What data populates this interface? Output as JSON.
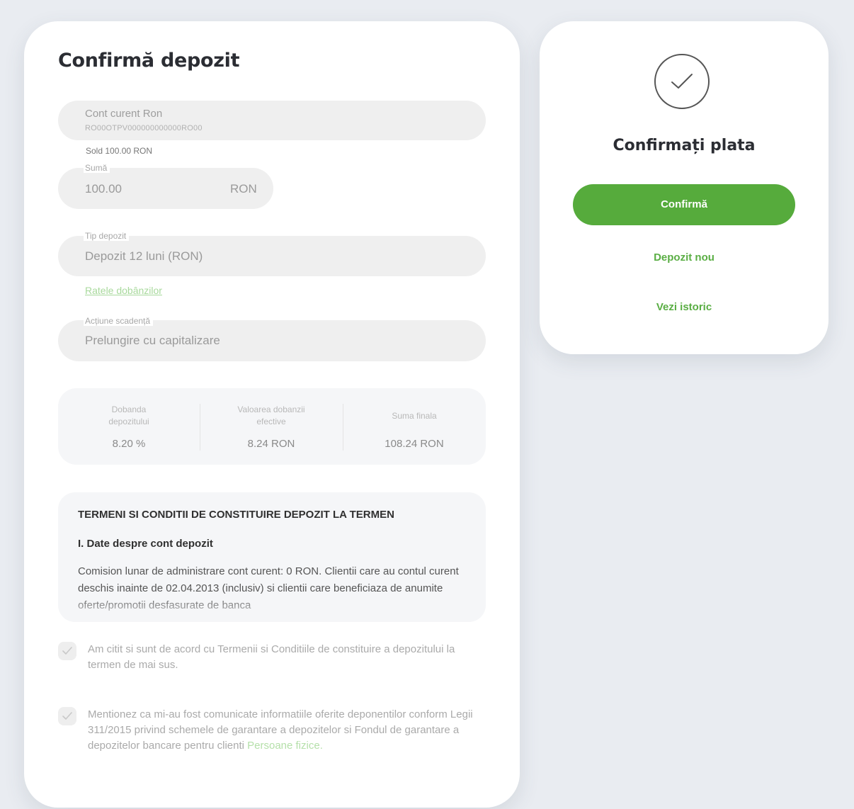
{
  "deposit": {
    "title": "Confirmă depozit",
    "account": {
      "name": "Cont curent Ron",
      "iban": "RO00OTPV000000000000RO00",
      "balance": "Sold  100.00  RON"
    },
    "amount": {
      "label": "Sumă",
      "value": "100.00",
      "currency": "RON"
    },
    "deposit_type": {
      "label": "Tip depozit",
      "value": "Depozit 12 luni (RON)"
    },
    "rates_link": "Ratele dobânzilor",
    "maturity_action": {
      "label": "Acțiune scadență",
      "value": "Prelungire cu capitalizare"
    },
    "summary": [
      {
        "label": "Dobanda depozitului",
        "value": "8.20 %"
      },
      {
        "label": "Valoarea dobanzii efective",
        "value": "8.24 RON"
      },
      {
        "label": "Suma finala",
        "value": "108.24 RON"
      }
    ],
    "terms": {
      "title": "TERMENI SI CONDITII DE CONSTITUIRE DEPOZIT LA TERMEN",
      "subtitle": "I. Date despre cont depozit",
      "text": "Comision lunar de administrare cont curent: 0 RON. Clientii care au contul curent deschis inainte de 02.04.2013 (inclusiv) si clientii care beneficiaza de anumite oferte/promotii desfasurate de banca"
    },
    "agreements": [
      {
        "text": "Am citit si sunt de acord cu Termenii si Conditiile de constituire a depozitului la termen de mai sus.",
        "checked": true
      },
      {
        "text": "Mentionez ca mi-au fost comunicate informatiile oferite deponentilor conform Legii 311/2015 privind schemele de garantare a depozitelor si Fondul de garantare a depozitelor bancare pentru clienti ",
        "link": "Persoane fizice.",
        "checked": true
      }
    ]
  },
  "confirmation": {
    "title": "Confirmați plata",
    "confirm_button": "Confirmă",
    "new_deposit_link": "Depozit nou",
    "history_link": "Vezi istoric"
  },
  "colors": {
    "accent_green": "#56ab3c",
    "link_green": "#5aae44",
    "background": "#e9ecf1"
  },
  "icons": {
    "success": "check-circle-icon",
    "checkbox": "checkmark-icon"
  }
}
